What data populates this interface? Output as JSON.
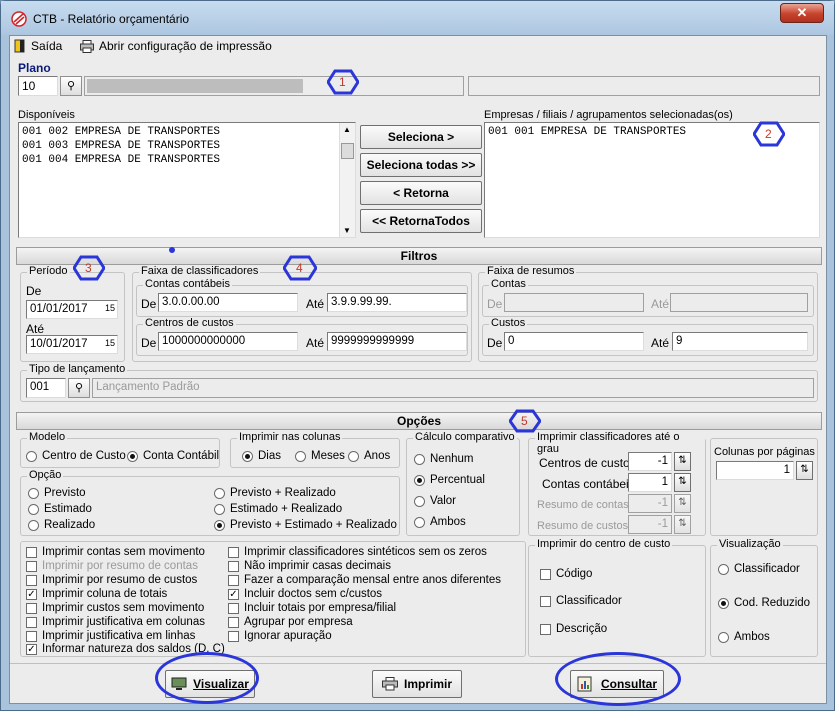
{
  "window": {
    "title": "CTB - Relatório orçamentário",
    "close_label": "✕"
  },
  "menu": {
    "exit_label": "Saída",
    "print_config_label": "Abrir configuração de impressão"
  },
  "plano": {
    "label": "Plano",
    "value": "10"
  },
  "disponiveis": {
    "label": "Disponíveis",
    "items": [
      "001 002 EMPRESA DE TRANSPORTES",
      "001 003 EMPRESA DE TRANSPORTES",
      "001 004 EMPRESA DE TRANSPORTES"
    ]
  },
  "transfer_buttons": {
    "select": "Seleciona >",
    "select_all": "Seleciona todas >>",
    "return": "< Retorna",
    "return_all": "<< RetornaTodos"
  },
  "selecionadas": {
    "label": "Empresas / filiais / agrupamentos selecionadas(os)",
    "items": [
      "001 001 EMPRESA DE TRANSPORTES"
    ]
  },
  "filtros": {
    "section_title": "Filtros",
    "periodo": {
      "title": "Período",
      "de_label": "De",
      "de_value": "01/01/2017",
      "ate_label": "Até",
      "ate_value": "10/01/2017"
    },
    "faixa_classificadores": {
      "title": "Faixa de classificadores",
      "contas_title": "Contas contábeis",
      "contas_de_label": "De",
      "contas_de": "3.0.0.00.00",
      "contas_ate_label": "Até",
      "contas_ate": "3.9.9.99.99.",
      "centros_title": "Centros de custos",
      "centros_de_label": "De",
      "centros_de": "1000000000000",
      "centros_ate_label": "Até",
      "centros_ate": "9999999999999"
    },
    "faixa_resumos": {
      "title": "Faixa de resumos",
      "contas_title": "Contas",
      "contas_de_label": "De",
      "contas_ate_label": "Até",
      "custos_title": "Custos",
      "custos_de_label": "De",
      "custos_de": "0",
      "custos_ate_label": "Até",
      "custos_ate": "9"
    },
    "tipo_lancamento": {
      "title": "Tipo de lançamento",
      "code": "001",
      "description": "Lançamento Padrão"
    }
  },
  "opcoes": {
    "section_title": "Opções",
    "modelo": {
      "title": "Modelo",
      "options": [
        "Centro de Custo",
        "Conta Contábil"
      ],
      "selected": 1
    },
    "imprimir_colunas": {
      "title": "Imprimir nas colunas",
      "options": [
        "Dias",
        "Meses",
        "Anos"
      ],
      "selected": 0
    },
    "calculo": {
      "title": "Cálculo comparativo",
      "options": [
        "Nenhum",
        "Percentual",
        "Valor",
        "Ambos"
      ],
      "selected": 1
    },
    "classificadores_grau": {
      "title": "Imprimir classificadores até o grau",
      "rows": [
        {
          "label": "Centros de custos",
          "value": "-1",
          "enabled": true
        },
        {
          "label": "Contas contábeis",
          "value": "1",
          "enabled": true
        },
        {
          "label": "Resumo de contas",
          "value": "-1",
          "enabled": false
        },
        {
          "label": "Resumo de custos",
          "value": "-1",
          "enabled": false
        }
      ]
    },
    "colunas_paginas": {
      "title": "Colunas por páginas",
      "value": "1"
    },
    "opcao": {
      "title": "Opção",
      "options": [
        "Previsto",
        "Estimado",
        "Realizado",
        "Previsto + Realizado",
        "Estimado + Realizado",
        "Previsto + Estimado + Realizado"
      ],
      "selected": 5
    },
    "checks_left": [
      {
        "label": "Imprimir contas sem movimento",
        "checked": false,
        "enabled": true
      },
      {
        "label": "Imprimir por resumo de contas",
        "checked": false,
        "enabled": false
      },
      {
        "label": "Imprimir por resumo de custos",
        "checked": false,
        "enabled": true
      },
      {
        "label": "Imprimir coluna de totais",
        "checked": true,
        "enabled": true
      },
      {
        "label": "Imprimir custos sem movimento",
        "checked": false,
        "enabled": true
      },
      {
        "label": "Imprimir justificativa em colunas",
        "checked": false,
        "enabled": true
      },
      {
        "label": "Imprimir justificativa em linhas",
        "checked": false,
        "enabled": true
      },
      {
        "label": "Informar natureza dos saldos (D, C)",
        "checked": true,
        "enabled": true
      }
    ],
    "checks_right": [
      {
        "label": "Imprimir classificadores sintéticos sem os zeros",
        "checked": false
      },
      {
        "label": "Não imprimir casas decimais",
        "checked": false
      },
      {
        "label": "Fazer a comparação mensal entre anos diferentes",
        "checked": false
      },
      {
        "label": "Incluir doctos sem c/custos",
        "checked": true
      },
      {
        "label": "Incluir totais por empresa/filial",
        "checked": false
      },
      {
        "label": "Agrupar por empresa",
        "checked": false
      },
      {
        "label": "Ignorar apuração",
        "checked": false
      }
    ],
    "imprimir_centro": {
      "title": "Imprimir do centro de custo",
      "options": [
        "Código",
        "Classificador",
        "Descrição"
      ]
    },
    "visualizacao": {
      "title": "Visualização",
      "options": [
        "Classificador",
        "Cod. Reduzido",
        "Ambos"
      ],
      "selected": 1
    }
  },
  "footer": {
    "visualizar": "Visualizar",
    "imprimir": "Imprimir",
    "consultar": "Consultar"
  },
  "annotations": {
    "m1": "1",
    "m2": "2",
    "m3": "3",
    "m4": "4",
    "m5": "5"
  },
  "colors": {
    "annotation": "#2b36d9",
    "annotation_text": "#c0392b",
    "title_bar": "#adc6e0"
  }
}
